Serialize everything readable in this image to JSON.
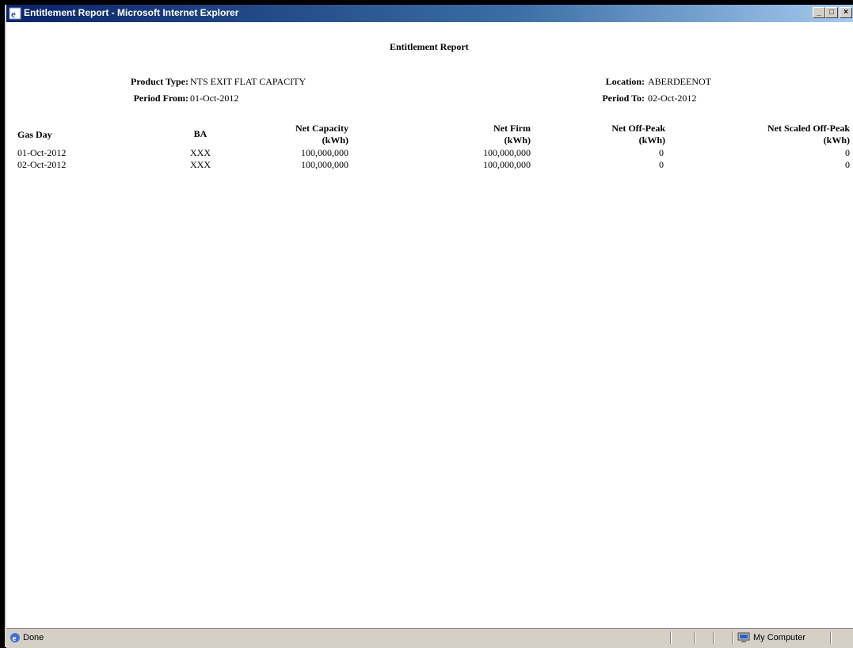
{
  "window": {
    "title": "Entitlement Report - Microsoft Internet Explorer",
    "min_label": "_",
    "max_label": "□",
    "close_label": "×"
  },
  "report": {
    "title": "Entitlement Report",
    "product_type_label": "Product Type:",
    "product_type_value": "NTS EXIT FLAT CAPACITY",
    "location_label": "Location:",
    "location_value": "ABERDEENOT",
    "period_from_label": "Period From:",
    "period_from_value": "01-Oct-2012",
    "period_to_label": "Period To:",
    "period_to_value": "02-Oct-2012"
  },
  "table": {
    "headers": {
      "gas_day": "Gas Day",
      "ba": "BA",
      "net_capacity": "Net Capacity",
      "net_firm": "Net Firm",
      "net_offpeak": "Net Off-Peak",
      "net_scaled": "Net Scaled Off-Peak",
      "unit": "(kWh)"
    },
    "rows": [
      {
        "gas_day": "01-Oct-2012",
        "ba": "XXX",
        "net_capacity": "100,000,000",
        "net_firm": "100,000,000",
        "net_offpeak": "0",
        "net_scaled": "0"
      },
      {
        "gas_day": "02-Oct-2012",
        "ba": "XXX",
        "net_capacity": "100,000,000",
        "net_firm": "100,000,000",
        "net_offpeak": "0",
        "net_scaled": "0"
      }
    ]
  },
  "status": {
    "text": "Done",
    "zone": "My Computer"
  },
  "icons": [
    "ie-icon",
    "computer-icon"
  ]
}
